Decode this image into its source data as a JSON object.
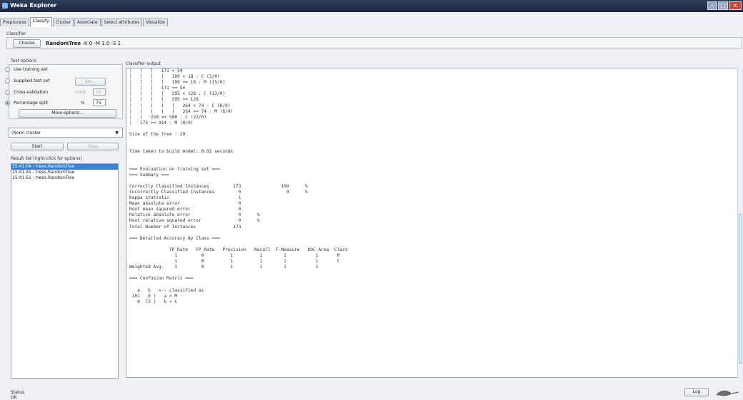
{
  "window": {
    "title": "Weka Explorer"
  },
  "tabs": [
    "Preprocess",
    "Classify",
    "Cluster",
    "Associate",
    "Select attributes",
    "Visualize"
  ],
  "classifier": {
    "section_label": "Classifier",
    "choose_label": "Choose",
    "name": "RandomTree",
    "options": "-K 0 -M 1.0 -S 1"
  },
  "test_options": {
    "label": "Test options",
    "use_training_set": "Use training set",
    "supplied_test_set": "Supplied test set",
    "set_label": "Set...",
    "cross_validation": "Cross-validation",
    "folds_label": "Folds",
    "folds_value": "10",
    "percentage_split": "Percentage split",
    "percent_symbol": "%",
    "percent_value": "75",
    "more_options": "More options..."
  },
  "class_select": {
    "value": "(Nom) cluster"
  },
  "actions": {
    "start": "Start",
    "stop": "Stop"
  },
  "result_list": {
    "label": "Result list (right-click for options)",
    "items": [
      "15:41:04 - trees.RandomTree",
      "15:41:41 - trees.RandomTree",
      "15:41:51 - trees.RandomTree"
    ]
  },
  "output": {
    "label": "Classifier output",
    "text": "|   |   |   171 < 54\n|   |   |   |   199 < 18 : C (3/0)\n|   |   |   |   199 >= 18 : M (15/0)\n|   |   |   171 >= 54\n|   |   |   |   295 < 128 : C (13/0)\n|   |   |   |   295 >= 128\n|   |   |   |   |   264 < 74 : C (6/0)\n|   |   |   |   |   264 >= 74 : M (6/0)\n|   |   228 >= 580 : C (22/0)\n|   173 >= 914 : M (8/0)\n\nSize of the tree : 29\n\n\nTime taken to build model: 0.02 seconds\n\n\n=== Evaluation on training set ===\n=== Summary ===\n\nCorrectly Classified Instances         173               100      %\nIncorrectly Classified Instances         0                 0      %\nKappa statistic                          1\nMean absolute error                      0\nRoot mean squared error                  0\nRelative absolute error                  0      %\nRoot relative squared error              0      %\nTotal Number of Instances              173\n\n=== Detailed Accuracy By Class ===\n\n               TP Rate   FP Rate   Precision   Recall  F-Measure   ROC Area  Class\n                 1         0          1          1        1           1       M\n                 1         0          1          1        1           1       C\nWeighted Avg.    1         0          1          1        1           1\n\n=== Confusion Matrix ===\n\n   a   b   <-- classified as\n 101   0 |   a = M\n   0  72 |   b = C"
  },
  "status": {
    "label": "Status",
    "value": "OK",
    "log_button": "Log"
  }
}
